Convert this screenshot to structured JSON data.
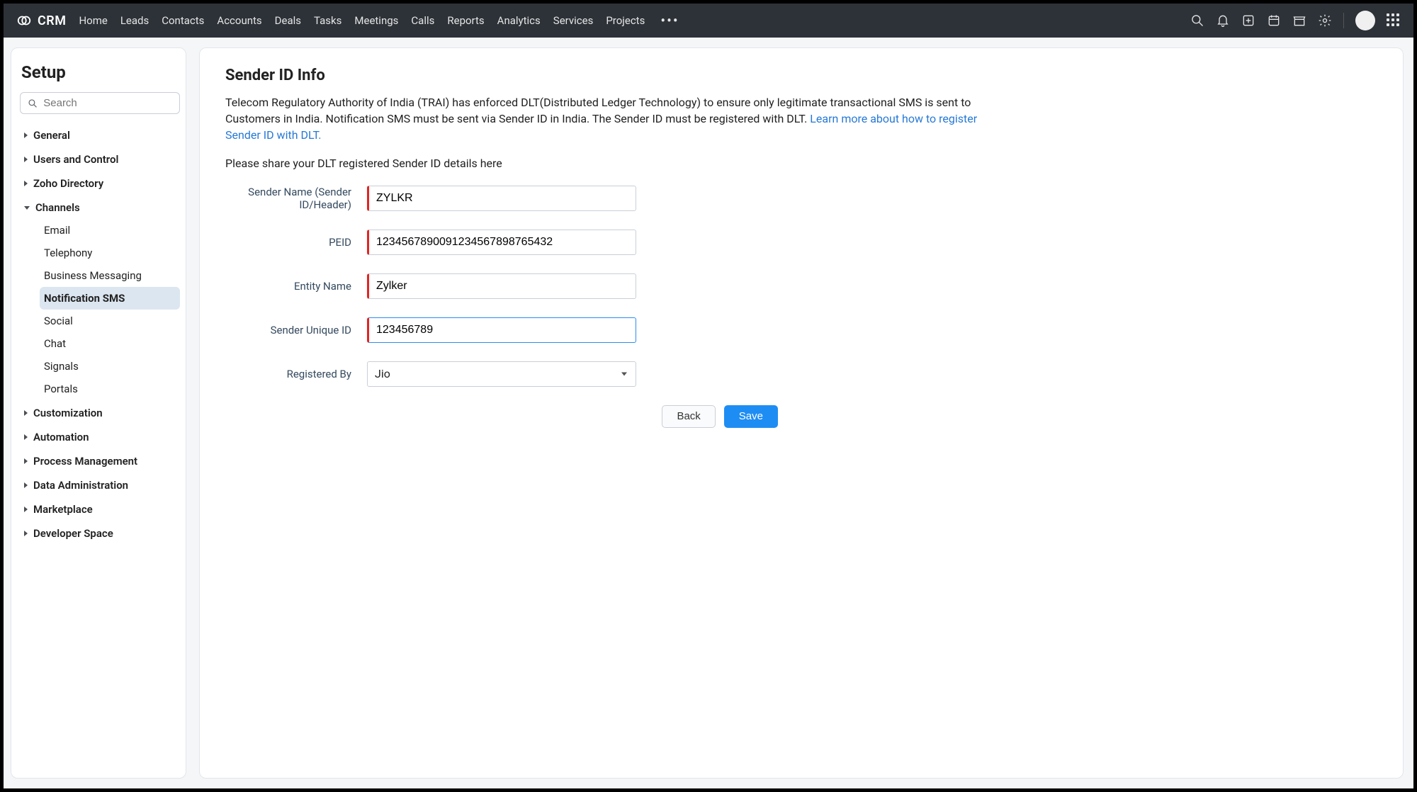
{
  "brand": "CRM",
  "topnav": [
    "Home",
    "Leads",
    "Contacts",
    "Accounts",
    "Deals",
    "Tasks",
    "Meetings",
    "Calls",
    "Reports",
    "Analytics",
    "Services",
    "Projects"
  ],
  "sidebar": {
    "title": "Setup",
    "search_placeholder": "Search",
    "groups": [
      {
        "label": "General",
        "open": false
      },
      {
        "label": "Users and Control",
        "open": false
      },
      {
        "label": "Zoho Directory",
        "open": false
      },
      {
        "label": "Channels",
        "open": true,
        "items": [
          {
            "label": "Email"
          },
          {
            "label": "Telephony"
          },
          {
            "label": "Business Messaging"
          },
          {
            "label": "Notification SMS",
            "active": true
          },
          {
            "label": "Social"
          },
          {
            "label": "Chat"
          },
          {
            "label": "Signals"
          },
          {
            "label": "Portals"
          }
        ]
      },
      {
        "label": "Customization",
        "open": false
      },
      {
        "label": "Automation",
        "open": false
      },
      {
        "label": "Process Management",
        "open": false
      },
      {
        "label": "Data Administration",
        "open": false
      },
      {
        "label": "Marketplace",
        "open": false
      },
      {
        "label": "Developer Space",
        "open": false
      }
    ]
  },
  "page": {
    "title": "Sender ID Info",
    "desc_pre": "Telecom Regulatory Authority of India (TRAI) has enforced DLT(Distributed Ledger Technology) to ensure only legitimate transactional SMS is sent to Customers in India. Notification SMS must be sent via Sender ID in India. The Sender ID must be registered with DLT. ",
    "desc_link": "Learn more about how to register Sender ID with DLT.",
    "hint": "Please share your DLT registered Sender ID details here",
    "fields": {
      "sender_name": {
        "label": "Sender Name (Sender ID/Header)",
        "value": "ZYLKR"
      },
      "peid": {
        "label": "PEID",
        "value": "12345678900912345678987​65432"
      },
      "entity_name": {
        "label": "Entity Name",
        "value": "Zylker"
      },
      "sender_unique_id": {
        "label": "Sender Unique ID",
        "value": "123456789"
      },
      "registered_by": {
        "label": "Registered By",
        "value": "Jio"
      }
    },
    "buttons": {
      "back": "Back",
      "save": "Save"
    }
  }
}
